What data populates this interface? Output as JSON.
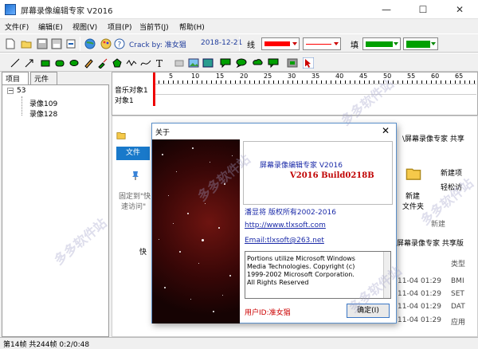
{
  "window": {
    "title": "屏幕录像编辑专家 V2016",
    "minimize": "—",
    "maximize": "☐",
    "close": "✕"
  },
  "menu": [
    "文件(F)",
    "编辑(E)",
    "视图(V)",
    "项目(P)",
    "当前节(J)",
    "帮助(H)"
  ],
  "toolbar1": {
    "crack": "Crack by: 准女猖",
    "date": "2018-12-21",
    "line_label": "线",
    "fill_label": "填",
    "line_color": "#ff0000",
    "fill_color": "#00a000"
  },
  "panel": {
    "tabs": [
      "项目",
      "元件"
    ],
    "tree_root": "53",
    "tree_items": [
      "录像109",
      "录像128"
    ]
  },
  "timeline": {
    "rows": [
      "音乐对象1",
      "对象1"
    ],
    "ticks": [
      "5",
      "10",
      "15",
      "20",
      "25",
      "30",
      "35",
      "40",
      "45",
      "50",
      "55",
      "60",
      "65"
    ]
  },
  "explorer": {
    "path": "\\屏幕录像专家 共享",
    "file_tab": "文件",
    "pin_text_1": "固定到\"快",
    "pin_text_2": "速访问\"",
    "new_folder_1": "新建",
    "new_folder_2": "文件夹",
    "new_item": "新建项",
    "easy_access": "轻松访",
    "new_group": "新建",
    "quick_access": "快",
    "share_path": "屏幕录像专家 共享版",
    "type_header": "类型",
    "rows": [
      {
        "time": "11-04 01:29",
        "type": "BMI"
      },
      {
        "time": "11-04 01:29",
        "type": "SET"
      },
      {
        "time": "11-04 01:29",
        "type": "DAT"
      },
      {
        "time": "11-04 01:29",
        "type": "应用"
      }
    ]
  },
  "about": {
    "title": "关于",
    "close": "✕",
    "app_name": "屏幕录像编辑专家 V2016",
    "build": "V2016 Build0218B",
    "copyright": "潘显将 版权所有2002-2016",
    "url": "http://www.tlxsoft.com",
    "email": "Email:tlxsoft@263.net",
    "credits": [
      "Portions utilize Microsoft Windows",
      "Media Technologies. Copyright (c)",
      "1999-2002 Microsoft Corporation.",
      "All Rights Reserved"
    ],
    "user_id": "用户ID:准女猖",
    "ok": "确定(I)"
  },
  "status": {
    "text": "第14帧 共244帧 0:2/0:48"
  },
  "watermarks": [
    "多多软件站",
    "多多软件站",
    "多多软件站",
    "多多软件站",
    "多多软件站"
  ]
}
